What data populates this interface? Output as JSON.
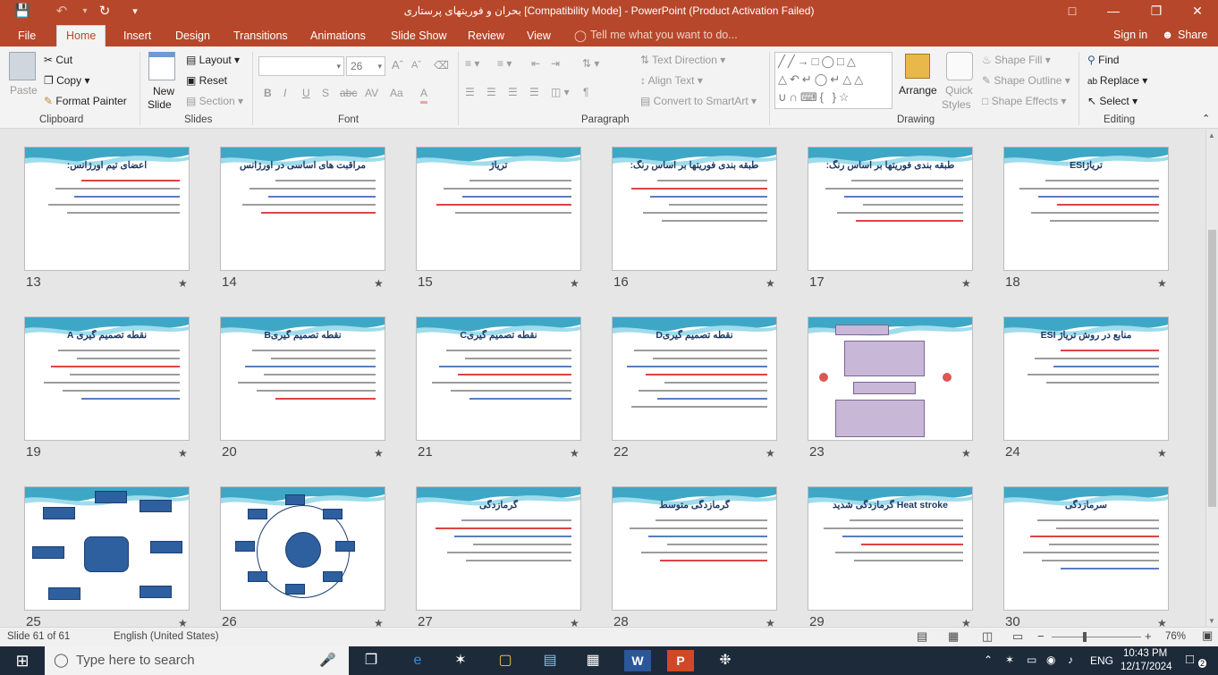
{
  "window": {
    "title": "بحران و فوریتهای پرستاری [Compatibility Mode] - PowerPoint (Product Activation Failed)"
  },
  "tabs": [
    "File",
    "Home",
    "Insert",
    "Design",
    "Transitions",
    "Animations",
    "Slide Show",
    "Review",
    "View"
  ],
  "tell_me": "Tell me what you want to do...",
  "account": {
    "sign_in": "Sign in",
    "share": "Share"
  },
  "ribbon": {
    "clipboard": {
      "paste": "Paste",
      "cut": "Cut",
      "copy": "Copy",
      "format_painter": "Format Painter",
      "label": "Clipboard"
    },
    "slides": {
      "new_slide": "New",
      "new_slide2": "Slide",
      "layout": "Layout",
      "reset": "Reset",
      "section": "Section",
      "label": "Slides"
    },
    "font": {
      "font_size": "26",
      "label": "Font"
    },
    "paragraph": {
      "text_direction": "Text Direction",
      "align_text": "Align Text",
      "smartart": "Convert to SmartArt",
      "label": "Paragraph"
    },
    "drawing": {
      "arrange": "Arrange",
      "quick1": "Quick",
      "quick2": "Styles",
      "shape_fill": "Shape Fill",
      "shape_outline": "Shape Outline",
      "shape_effects": "Shape Effects",
      "label": "Drawing"
    },
    "editing": {
      "find": "Find",
      "replace": "Replace",
      "select": "Select",
      "label": "Editing"
    }
  },
  "slides": [
    {
      "n": "13",
      "title": "اعضای تیم اورژانس:"
    },
    {
      "n": "14",
      "title": "مراقبت های اساسی در اورژانس"
    },
    {
      "n": "15",
      "title": "تریاژ"
    },
    {
      "n": "16",
      "title": "طبقه بندی فوریتها بر اساس رنگ:"
    },
    {
      "n": "17",
      "title": "طبقه بندی فوریتها بر اساس رنگ:"
    },
    {
      "n": "18",
      "title": "تریاژESI"
    },
    {
      "n": "19",
      "title": "نقطه تصمیم گیری A"
    },
    {
      "n": "20",
      "title": "نقطه تصمیم گیریB"
    },
    {
      "n": "21",
      "title": "نقطه تصمیم گیریC"
    },
    {
      "n": "22",
      "title": "نقطه تصمیم گیریD"
    },
    {
      "n": "23",
      "title": ""
    },
    {
      "n": "24",
      "title": "منابع در روش تریاژ ESI"
    },
    {
      "n": "25",
      "title": ""
    },
    {
      "n": "26",
      "title": ""
    },
    {
      "n": "27",
      "title": "گرمازدگی"
    },
    {
      "n": "28",
      "title": "گرمازدگی متوسط"
    },
    {
      "n": "29",
      "title": "Heat stroke گرمازدگی شدید"
    },
    {
      "n": "30",
      "title": "سرمازدگی"
    }
  ],
  "status": {
    "slide": "Slide 61 of 61",
    "language": "English (United States)",
    "zoom": "76%"
  },
  "taskbar": {
    "search": "Type here to search",
    "lang": "ENG",
    "time": "10:43 PM",
    "date": "12/17/2024",
    "badge": "2"
  }
}
